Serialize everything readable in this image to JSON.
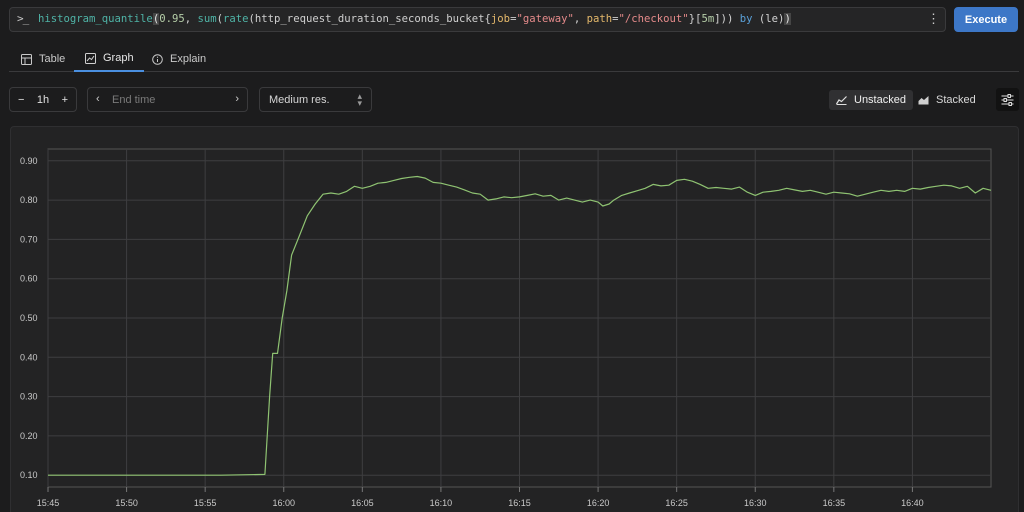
{
  "query": {
    "prompt_icon": "terminal-prompt-icon",
    "tokens": [
      {
        "text": "histogram_quantile",
        "cls": "tok-fn"
      },
      {
        "text": "(",
        "cls": "tok-hl"
      },
      {
        "text": "0.95",
        "cls": "tok-num"
      },
      {
        "text": ", ",
        "cls": ""
      },
      {
        "text": "sum",
        "cls": "tok-fn"
      },
      {
        "text": "(",
        "cls": "tok-brk"
      },
      {
        "text": "rate",
        "cls": "tok-fn"
      },
      {
        "text": "(",
        "cls": "tok-brk"
      },
      {
        "text": "http_request_duration_seconds_bucket",
        "cls": ""
      },
      {
        "text": "{",
        "cls": "tok-brk"
      },
      {
        "text": "job",
        "cls": "tok-label"
      },
      {
        "text": "=",
        "cls": ""
      },
      {
        "text": "\"gateway\"",
        "cls": "tok-str"
      },
      {
        "text": ", ",
        "cls": ""
      },
      {
        "text": "path",
        "cls": "tok-label"
      },
      {
        "text": "=",
        "cls": ""
      },
      {
        "text": "\"/checkout\"",
        "cls": "tok-str"
      },
      {
        "text": "}",
        "cls": "tok-brk"
      },
      {
        "text": "[",
        "cls": "tok-brk"
      },
      {
        "text": "5m",
        "cls": "tok-num"
      },
      {
        "text": "]",
        "cls": "tok-brk"
      },
      {
        "text": "))",
        "cls": "tok-brk"
      },
      {
        "text": " by ",
        "cls": "tok-kw"
      },
      {
        "text": "(le)",
        "cls": "tok-brk"
      },
      {
        "text": ")",
        "cls": "tok-hl"
      }
    ],
    "menu_icon": "kebab-menu-icon"
  },
  "execute_label": "Execute",
  "tabs": [
    {
      "label": "Table",
      "icon": "table-icon"
    },
    {
      "label": "Graph",
      "icon": "graph-icon",
      "active": true
    },
    {
      "label": "Explain",
      "icon": "info-icon"
    }
  ],
  "controls": {
    "range_minus": "−",
    "range_value": "1h",
    "range_plus": "+",
    "end_time_placeholder": "End time",
    "resolution": "Medium res.",
    "unstacked": "Unstacked",
    "stacked": "Stacked",
    "settings_icon": "sliders-icon"
  },
  "chart_data": {
    "type": "line",
    "yticks": [
      "0.90",
      "0.80",
      "0.70",
      "0.60",
      "0.50",
      "0.40",
      "0.30",
      "0.20",
      "0.10"
    ],
    "xticks": [
      "15:45",
      "15:50",
      "15:55",
      "16:00",
      "16:05",
      "16:10",
      "16:15",
      "16:20",
      "16:25",
      "16:30",
      "16:35",
      "16:40"
    ],
    "ylim": [
      0.07,
      0.93
    ],
    "x_start_minutes": 0,
    "x_end_minutes": 60,
    "grid": true,
    "series": [
      {
        "color": "#8fc372",
        "points": [
          [
            0,
            0.1
          ],
          [
            2,
            0.1
          ],
          [
            5,
            0.1
          ],
          [
            8,
            0.1
          ],
          [
            11,
            0.1
          ],
          [
            13.8,
            0.102
          ],
          [
            14.1,
            0.3
          ],
          [
            14.3,
            0.41
          ],
          [
            14.6,
            0.41
          ],
          [
            14.9,
            0.5
          ],
          [
            15.2,
            0.57
          ],
          [
            15.5,
            0.66
          ],
          [
            16.0,
            0.71
          ],
          [
            16.5,
            0.76
          ],
          [
            17.0,
            0.79
          ],
          [
            17.5,
            0.815
          ],
          [
            18.0,
            0.818
          ],
          [
            18.5,
            0.815
          ],
          [
            19.0,
            0.822
          ],
          [
            19.5,
            0.835
          ],
          [
            20.0,
            0.83
          ],
          [
            20.5,
            0.835
          ],
          [
            21.0,
            0.843
          ],
          [
            21.5,
            0.845
          ],
          [
            22.0,
            0.85
          ],
          [
            22.5,
            0.855
          ],
          [
            23.0,
            0.858
          ],
          [
            23.5,
            0.86
          ],
          [
            24.0,
            0.856
          ],
          [
            24.5,
            0.845
          ],
          [
            25.0,
            0.843
          ],
          [
            25.5,
            0.838
          ],
          [
            26.0,
            0.833
          ],
          [
            26.5,
            0.826
          ],
          [
            27.0,
            0.818
          ],
          [
            27.5,
            0.815
          ],
          [
            28.0,
            0.8
          ],
          [
            28.5,
            0.803
          ],
          [
            29.0,
            0.808
          ],
          [
            29.5,
            0.806
          ],
          [
            30.0,
            0.808
          ],
          [
            30.5,
            0.812
          ],
          [
            31.0,
            0.816
          ],
          [
            31.5,
            0.81
          ],
          [
            32.0,
            0.812
          ],
          [
            32.5,
            0.8
          ],
          [
            33.0,
            0.805
          ],
          [
            33.5,
            0.8
          ],
          [
            34.0,
            0.795
          ],
          [
            34.5,
            0.8
          ],
          [
            35.0,
            0.795
          ],
          [
            35.3,
            0.785
          ],
          [
            35.7,
            0.79
          ],
          [
            36.0,
            0.8
          ],
          [
            36.5,
            0.812
          ],
          [
            37.0,
            0.818
          ],
          [
            37.5,
            0.824
          ],
          [
            38.0,
            0.83
          ],
          [
            38.5,
            0.84
          ],
          [
            39.0,
            0.836
          ],
          [
            39.5,
            0.838
          ],
          [
            40.0,
            0.85
          ],
          [
            40.5,
            0.853
          ],
          [
            41.0,
            0.848
          ],
          [
            41.5,
            0.84
          ],
          [
            42.0,
            0.83
          ],
          [
            42.5,
            0.832
          ],
          [
            43.0,
            0.83
          ],
          [
            43.5,
            0.828
          ],
          [
            44.0,
            0.833
          ],
          [
            44.5,
            0.82
          ],
          [
            45.0,
            0.812
          ],
          [
            45.5,
            0.82
          ],
          [
            46.0,
            0.822
          ],
          [
            46.5,
            0.825
          ],
          [
            47.0,
            0.83
          ],
          [
            47.5,
            0.826
          ],
          [
            48.0,
            0.822
          ],
          [
            48.5,
            0.825
          ],
          [
            49.0,
            0.82
          ],
          [
            49.5,
            0.815
          ],
          [
            50.0,
            0.82
          ],
          [
            50.5,
            0.818
          ],
          [
            51.0,
            0.816
          ],
          [
            51.5,
            0.81
          ],
          [
            52.0,
            0.815
          ],
          [
            52.5,
            0.82
          ],
          [
            53.0,
            0.825
          ],
          [
            53.5,
            0.822
          ],
          [
            54.0,
            0.825
          ],
          [
            54.5,
            0.822
          ],
          [
            55.0,
            0.83
          ],
          [
            55.5,
            0.828
          ],
          [
            56.0,
            0.832
          ],
          [
            56.5,
            0.835
          ],
          [
            57.0,
            0.838
          ],
          [
            57.5,
            0.836
          ],
          [
            58.0,
            0.83
          ],
          [
            58.5,
            0.835
          ],
          [
            59.0,
            0.818
          ],
          [
            59.5,
            0.83
          ],
          [
            60.0,
            0.825
          ]
        ]
      }
    ]
  }
}
